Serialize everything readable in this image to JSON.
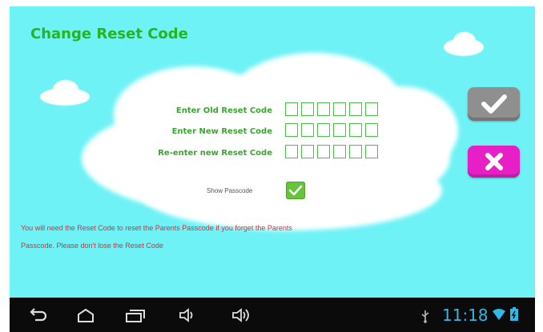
{
  "screen": {
    "title": "Change Reset Code",
    "fields": [
      {
        "label": "Enter Old  Reset Code",
        "digits": 6
      },
      {
        "label": "Enter New Reset Code",
        "digits": 6
      },
      {
        "label": "Re-enter new Reset Code",
        "digits": 6
      }
    ],
    "show_passcode": {
      "label": "Show Passcode",
      "checked": true
    },
    "message_line1": "You will need the Reset Code to reset the Parents Passcode if you forget the Parents",
    "message_line2": "Passcode. Please don't lose the Reset Code"
  },
  "actions": {
    "confirm_icon": "check-icon",
    "cancel_icon": "close-icon"
  },
  "status_bar": {
    "time": "11:18",
    "icons": [
      "usb-icon",
      "wifi-icon",
      "battery-icon"
    ]
  },
  "nav_bar": {
    "icons": [
      "back-icon",
      "home-icon",
      "recent-apps-icon",
      "volume-down-icon",
      "volume-up-icon"
    ]
  },
  "colors": {
    "background": "#6ef2f6",
    "title": "#27b51c",
    "labels": "#3aa530",
    "message": "#e02b35",
    "confirm_button": "#8f8f8f",
    "cancel_button": "#e81fc6",
    "clock": "#34b7e4"
  }
}
